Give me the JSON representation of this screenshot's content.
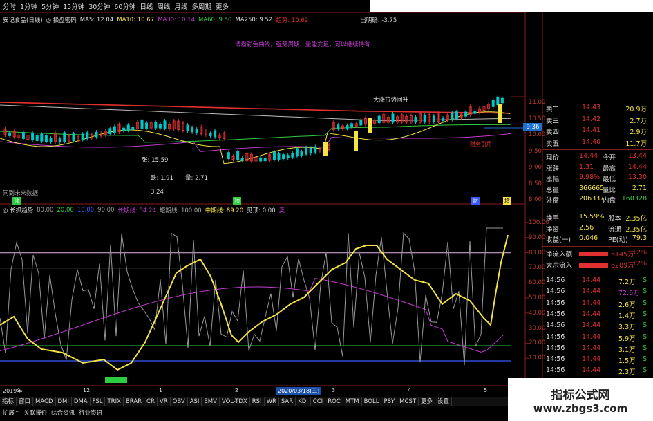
{
  "period_tabs": [
    "分时",
    "1分钟",
    "5分钟",
    "15分钟",
    "30分钟",
    "60分钟",
    "日线",
    "周线",
    "月线",
    "多周期",
    "更多"
  ],
  "info_bar": {
    "stock": "安记食品(日线)",
    "marker": "◎ 操盘密码",
    "ma5": "MA5: 12.04",
    "ma10": "MA10: 10.67",
    "ma30": "MA30: 10.14",
    "ma60": "MA60: 9.50",
    "ma250": "MA250: 9.52",
    "extra": "趋势: 10.62",
    "right": "出明确: -3.75"
  },
  "hint_text": "请看彩色曲线，强势周期，量能充足，可以继续持有",
  "chart_labels": {
    "zhang": "张: 15.59",
    "die": "跌: 1.91",
    "liang": "量: 2.71",
    "ratio": "3.24",
    "bottom_left": "同到未来数据",
    "tag_ding": "顶",
    "tag_cai": "财",
    "tag_zeng": "增",
    "da": "大涨拉势回升",
    "price_label": "9.36",
    "caiyin": "财务引用"
  },
  "main_axis": [
    "11.00",
    "10.50",
    "10.00",
    "9.50",
    "9.00",
    "8.50",
    "8.00"
  ],
  "indicator_bar": {
    "name": "◎ 长抓趋势",
    "a": "80.00",
    "b": "20.00",
    "c": "10.00",
    "d": "90.00",
    "long": "长期线: 54.24",
    "short": "短期线: 100.00",
    "mid": "中期线: 89.20",
    "buy": "见顶: 0.00",
    "tail": "卖"
  },
  "ind_axis": [
    "100.00",
    "90.00",
    "80.00",
    "70.00",
    "60.00",
    "50.00",
    "40.00",
    "30.00",
    "20.00",
    "10.00"
  ],
  "date_bar": {
    "year": "2019年",
    "m12": "12",
    "m1": "1",
    "m2": "2",
    "date": "2020/03/18(三)",
    "m3": "3",
    "m4": "4",
    "m5": "5"
  },
  "bottom_tabs": [
    "指标",
    "窗口",
    "MACD",
    "DMI",
    "DMA",
    "FSL",
    "TRIX",
    "BRAR",
    "CR",
    "VR",
    "OBV",
    "ASI",
    "EMV",
    "VOL-TDX",
    "RSI",
    "WR",
    "SAR",
    "KDJ",
    "CCI",
    "ROC",
    "MTM",
    "BOLL",
    "PSY",
    "MCST",
    "更多",
    "设置"
  ],
  "bottom_links": [
    "扩展↑",
    "关联报价",
    "综合资讯",
    "行业资讯"
  ],
  "quote_asks": [
    {
      "label": "卖二",
      "price": "14.43",
      "vol": "20.9万"
    },
    {
      "label": "卖三",
      "price": "14.42",
      "vol": "2.7万"
    },
    {
      "label": "卖四",
      "price": "14.41",
      "vol": "2.9万"
    },
    {
      "label": "卖五",
      "price": "14.40",
      "vol": "11.7万"
    }
  ],
  "quote_stats": [
    {
      "l1": "现价",
      "v1": "14.44",
      "l2": "今开",
      "v2": "13.44"
    },
    {
      "l1": "涨跌",
      "v1": "1.31",
      "l2": "最高",
      "v2": "14.44"
    },
    {
      "l1": "涨幅",
      "v1": "9.98%",
      "l2": "最低",
      "v2": "13.30"
    },
    {
      "l1": "总量",
      "v1": "366665",
      "l2": "量比",
      "v2": "2.71"
    },
    {
      "l1": "外盘",
      "v1": "206337",
      "l2": "内盘",
      "v2": "160328"
    }
  ],
  "quote_fin": [
    {
      "l1": "换手",
      "v1": "15.59%",
      "l2": "股本",
      "v2": "2.35亿"
    },
    {
      "l1": "净资",
      "v1": "2.56",
      "l2": "流通",
      "v2": "2.35亿"
    },
    {
      "l1": "收益(一)",
      "v1": "0.046",
      "l2": "PE(动)",
      "v2": "79.3"
    }
  ],
  "flows": [
    {
      "label": "净流入额",
      "value": "6145万",
      "pct": "12%"
    },
    {
      "label": "大宗流入",
      "value": "6209万",
      "pct": "12%"
    }
  ],
  "ticks": [
    {
      "t": "14:56",
      "p": "14.44",
      "v": "7.2万",
      "s": "S"
    },
    {
      "t": "14:56",
      "p": "14.44",
      "v": "72.6万",
      "s": "S"
    },
    {
      "t": "14:56",
      "p": "14.44",
      "v": "2.6万",
      "s": "S"
    },
    {
      "t": "14:56",
      "p": "14.44",
      "v": "1.4万",
      "s": "S"
    },
    {
      "t": "14:56",
      "p": "14.44",
      "v": "3.3万",
      "s": "S"
    },
    {
      "t": "14:56",
      "p": "14.44",
      "v": "5.9万",
      "s": "S"
    },
    {
      "t": "14:56",
      "p": "14.44",
      "v": "3.1万",
      "s": "S"
    },
    {
      "t": "14:56",
      "p": "14.44",
      "v": "1.5万",
      "s": "S"
    },
    {
      "t": "14:56",
      "p": "14.44",
      "v": "2.3万",
      "s": "S"
    }
  ],
  "watermark": {
    "title": "指标公式网",
    "url": "www.zbgs3.com"
  },
  "colors": {
    "up": "#e23030",
    "down": "#00c8c8",
    "yellow": "#f5e342",
    "magenta": "#c33bd1",
    "green": "#2ecc40",
    "blue": "#3b5bff"
  }
}
